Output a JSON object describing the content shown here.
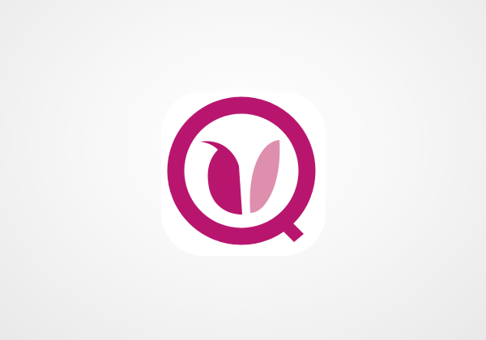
{
  "logo": {
    "icon_name": "tulip-logo-icon",
    "colors": {
      "ring": "#b8166e",
      "left_petal": "#b8166e",
      "right_petal": "#de8fae",
      "tile": "#ffffff",
      "background": "#efefef"
    }
  }
}
